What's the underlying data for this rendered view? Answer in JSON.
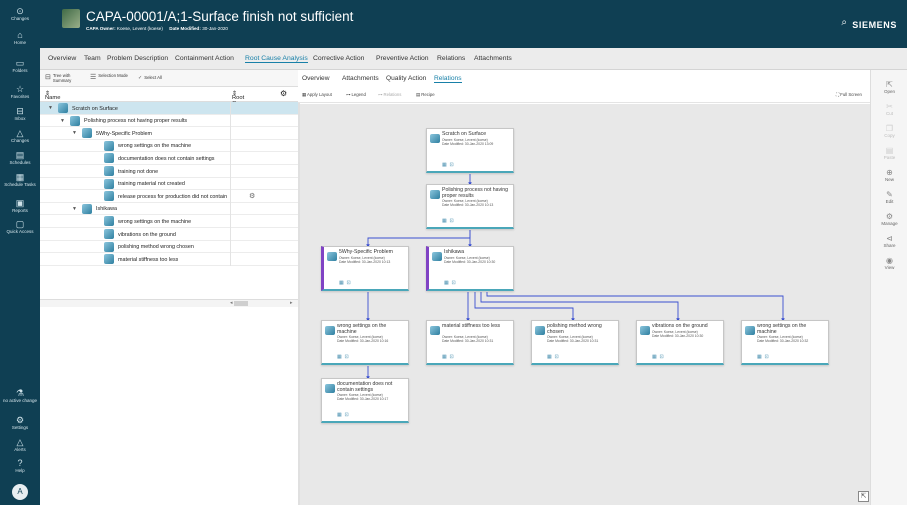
{
  "nav": {
    "changes": "Changes",
    "home": "Home",
    "folders": "Folders",
    "favorites": "Favorites",
    "inbox": "Inbox",
    "changes2": "Changes",
    "schedules": "Schedules",
    "schedule_tasks": "Schedule Tasks",
    "reports": "Reports",
    "quick_access": "Quick Access",
    "no_active_change": "no active change",
    "settings": "Settings",
    "alerts": "Alerts",
    "help": "Help",
    "avatar": "A"
  },
  "header": {
    "title": "CAPA-00001/A;1-Surface finish not sufficient",
    "owner_label": "CAPA Owner:",
    "owner": "Koese, Levent (koese)",
    "modified_label": "Date Modified:",
    "modified": "30-Jan-2020",
    "brand": "SIEMENS"
  },
  "tabs": [
    "Overview",
    "Team",
    "Problem Description",
    "Containment Action",
    "Root Cause Analysis",
    "Corrective Action",
    "Preventive Action",
    "Relations",
    "Attachments"
  ],
  "left_toolbar": {
    "tree_summary": "Tree with Summary",
    "selection_mode": "Selection Mode",
    "select_all": "Select All"
  },
  "tree_header": {
    "name": "Name",
    "root_cause": "Root Cause"
  },
  "tree_rows": [
    {
      "label": "Scratch on Surface",
      "level": 0,
      "expand": "▼"
    },
    {
      "label": "Polishing process not having proper results",
      "level": 1,
      "expand": "▼"
    },
    {
      "label": "5Why-Specific Problem",
      "level": 2,
      "expand": "▼"
    },
    {
      "label": "wrong settings on the machine",
      "level": 3,
      "expand": ""
    },
    {
      "label": "documentation does not contain settings",
      "level": 3,
      "expand": ""
    },
    {
      "label": "training not done",
      "level": 3,
      "expand": ""
    },
    {
      "label": "training material not created",
      "level": 3,
      "expand": ""
    },
    {
      "label": "release process for production did not contain",
      "level": 3,
      "expand": ""
    },
    {
      "label": "Ishikawa",
      "level": 2,
      "expand": "▼"
    },
    {
      "label": "wrong settings on the machine",
      "level": 3,
      "expand": ""
    },
    {
      "label": "vibrations on the ground",
      "level": 3,
      "expand": ""
    },
    {
      "label": "polishing method wrong chosen",
      "level": 3,
      "expand": ""
    },
    {
      "label": "material stiffness too less",
      "level": 3,
      "expand": ""
    }
  ],
  "right_tabs": [
    "Overview",
    "Attachments",
    "Quality Action",
    "Relations"
  ],
  "right_toolbar": {
    "apply_layout": "Apply Layout",
    "legend": "Legend",
    "relations": "Relations",
    "recipe": "Recipe",
    "full_screen": "Full Screen"
  },
  "nodes": [
    {
      "title": "Scratch on Surface",
      "owner": "Owner: Koese, Levent (koese)",
      "date": "Date Modified: 30-Jan-2020 13:09"
    },
    {
      "title": "Polishing process not having proper results",
      "owner": "Owner: Koese, Levent (koese)",
      "date": "Date Modified: 30-Jan-2020 10:13"
    },
    {
      "title": "5Why-Specific Problem",
      "owner": "Owner: Koese, Levent (koese)",
      "date": "Date Modified: 30-Jan-2020 10:13"
    },
    {
      "title": "Ishikawa",
      "owner": "Owner: Koese, Levent (koese)",
      "date": "Date Modified: 30-Jan-2020 10:30"
    },
    {
      "title": "wrong settings on the machine",
      "owner": "Owner: Koese, Levent (koese)",
      "date": "Date Modified: 30-Jan-2020 10:16"
    },
    {
      "title": "material stiffness too less",
      "owner": "Owner: Koese, Levent (koese)",
      "date": "Date Modified: 30-Jan-2020 10:31"
    },
    {
      "title": "polishing method wrong chosen",
      "owner": "Owner: Koese, Levent (koese)",
      "date": "Date Modified: 30-Jan-2020 10:31"
    },
    {
      "title": "vibrations on the ground",
      "owner": "Owner: Koese, Levent (koese)",
      "date": "Date Modified: 30-Jan-2020 10:30"
    },
    {
      "title": "wrong settings on the machine",
      "owner": "Owner: Koese, Levent (koese)",
      "date": "Date Modified: 30-Jan-2020 10:32"
    },
    {
      "title": "documentation does not contain settings",
      "owner": "Owner: Koese, Levent (koese)",
      "date": "Date Modified: 30-Jan-2020 10:17"
    }
  ],
  "actions": [
    "Open",
    "Cut",
    "Copy",
    "Paste",
    "New",
    "Edit",
    "Manage",
    "Share",
    "View"
  ],
  "colors": {
    "nav": "#0f3f53",
    "accent": "#1880a8",
    "purple": "#8043c4",
    "teal": "#4aa7b9",
    "link": "#3a4fd0"
  }
}
